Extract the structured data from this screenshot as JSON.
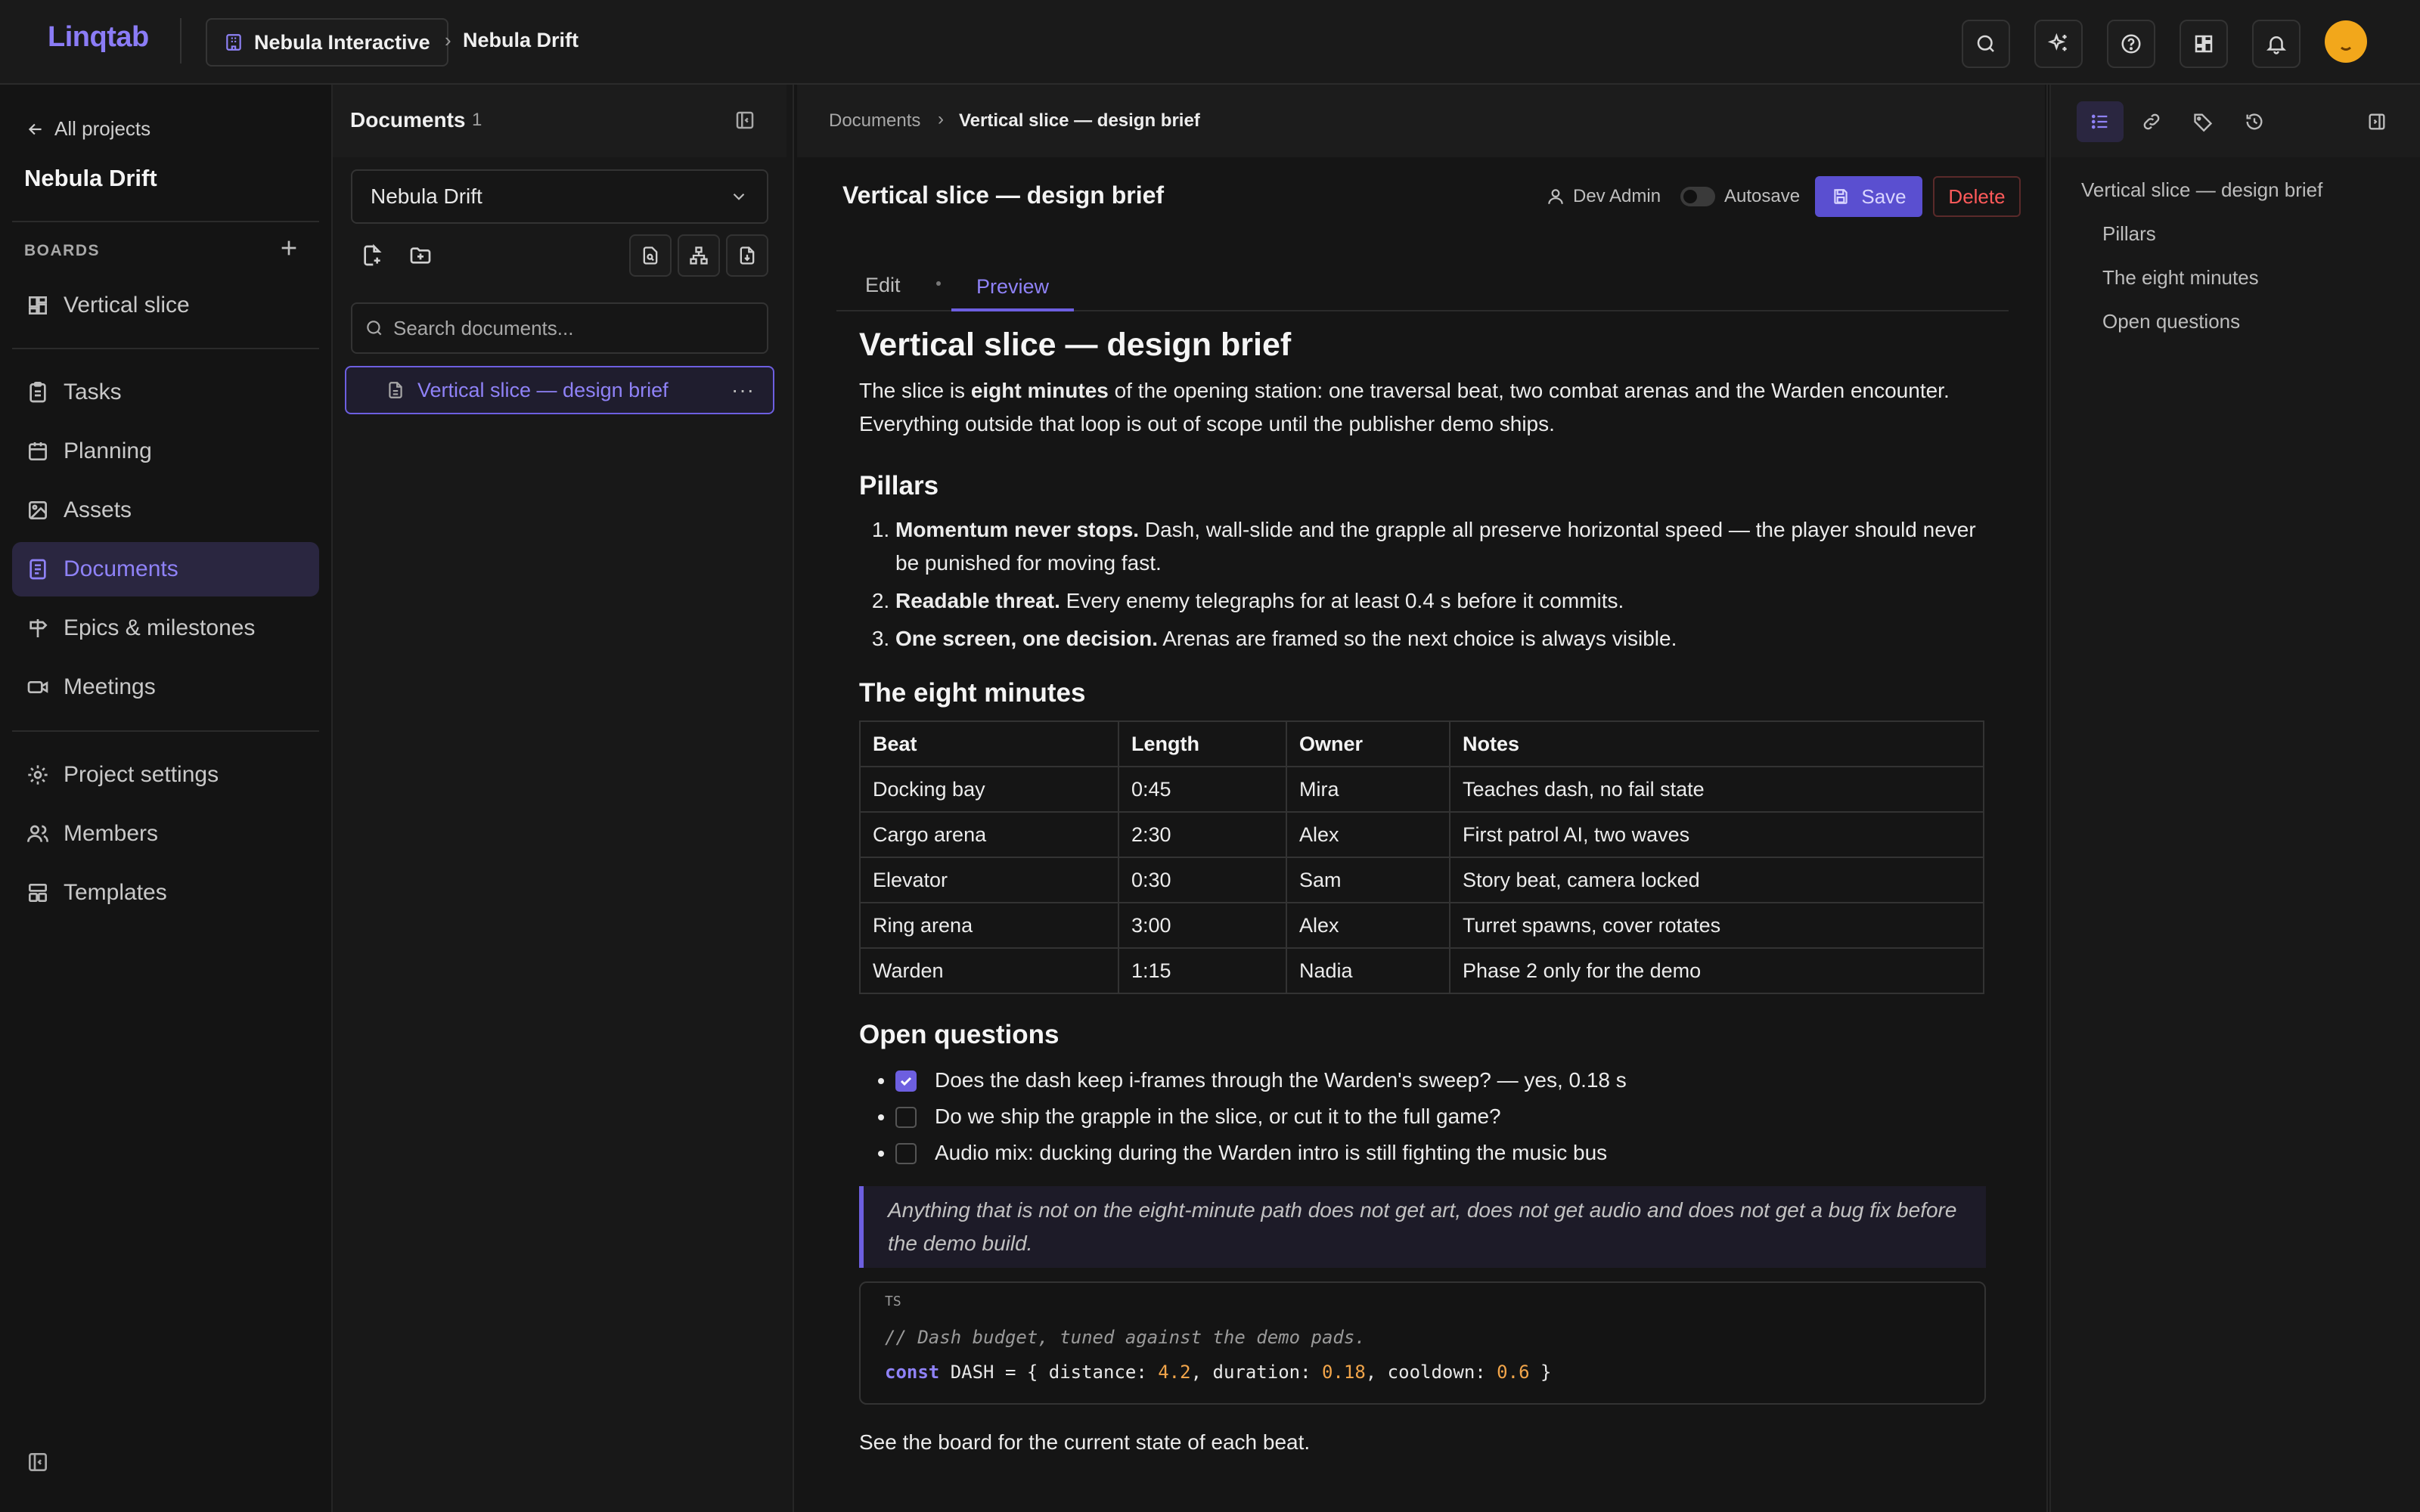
{
  "app": {
    "name": "Linqtab",
    "org": "Nebula Interactive",
    "project_crumb": "Nebula Drift",
    "crumb_separator": "›",
    "accent_color": "#8b7cf6",
    "avatar_color": "#f2a71b"
  },
  "topbar": {
    "icons": [
      "search-icon",
      "sparkles-icon",
      "help-icon",
      "apps-grid-icon",
      "bell-icon"
    ]
  },
  "sidebar": {
    "back_label": "All projects",
    "project_title": "Nebula Drift",
    "boards_label": "BOARDS",
    "boards": [
      {
        "label": "Vertical slice",
        "icon": "board-icon"
      }
    ],
    "nav": [
      {
        "label": "Tasks",
        "icon": "clipboard-icon"
      },
      {
        "label": "Planning",
        "icon": "calendar-icon"
      },
      {
        "label": "Assets",
        "icon": "image-icon"
      },
      {
        "label": "Documents",
        "icon": "document-list-icon",
        "active": true
      },
      {
        "label": "Epics & milestones",
        "icon": "signpost-icon"
      },
      {
        "label": "Meetings",
        "icon": "video-icon"
      }
    ],
    "settings_nav": [
      {
        "label": "Project settings",
        "icon": "gear-icon"
      },
      {
        "label": "Members",
        "icon": "users-icon"
      },
      {
        "label": "Templates",
        "icon": "template-icon"
      }
    ]
  },
  "documents_panel": {
    "title": "Documents",
    "count": "1",
    "project_select": "Nebula Drift",
    "search_placeholder": "Search documents...",
    "items": [
      {
        "label": "Vertical slice — design brief",
        "more": "···"
      }
    ]
  },
  "editor": {
    "breadcrumb_root": "Documents",
    "breadcrumb_sep": "›",
    "breadcrumb_current": "Vertical slice — design brief",
    "title": "Vertical slice — design brief",
    "user": "Dev Admin",
    "autosave_label": "Autosave",
    "autosave_on": false,
    "save_label": "Save",
    "delete_label": "Delete",
    "tabs": {
      "edit": "Edit",
      "preview": "Preview",
      "active": "Preview"
    }
  },
  "document": {
    "h1": "Vertical slice — design brief",
    "intro": {
      "before": "The slice is ",
      "bold": "eight minutes",
      "after": " of the opening station: one traversal beat, two combat arenas and the Warden encounter. Everything outside that loop is out of scope until the publisher demo ships."
    },
    "pillars_heading": "Pillars",
    "pillars": [
      {
        "bold": "Momentum never stops.",
        "text": " Dash, wall-slide and the grapple all preserve horizontal speed — the player should never be punished for moving fast."
      },
      {
        "bold": "Readable threat.",
        "text": " Every enemy telegraphs for at least 0.4 s before it commits."
      },
      {
        "bold": "One screen, one decision.",
        "text": " Arenas are framed so the next choice is always visible."
      }
    ],
    "beats_heading": "The eight minutes",
    "beats_columns": [
      "Beat",
      "Length",
      "Owner",
      "Notes"
    ],
    "beats_rows": [
      [
        "Docking bay",
        "0:45",
        "Mira",
        "Teaches dash, no fail state"
      ],
      [
        "Cargo arena",
        "2:30",
        "Alex",
        "First patrol AI, two waves"
      ],
      [
        "Elevator",
        "0:30",
        "Sam",
        "Story beat, camera locked"
      ],
      [
        "Ring arena",
        "3:00",
        "Alex",
        "Turret spawns, cover rotates"
      ],
      [
        "Warden",
        "1:15",
        "Nadia",
        "Phase 2 only for the demo"
      ]
    ],
    "questions_heading": "Open questions",
    "questions": [
      {
        "text": "Does the dash keep i-frames through the Warden's sweep? — yes, 0.18 s",
        "checked": true
      },
      {
        "text": "Do we ship the grapple in the slice, or cut it to the full game?",
        "checked": false
      },
      {
        "text": "Audio mix: ducking during the Warden intro is still fighting the music bus",
        "checked": false
      }
    ],
    "quote": "Anything that is not on the eight-minute path does not get art, does not get audio and does not get a bug fix before the demo build.",
    "code": {
      "lang": "TS",
      "comment": "// Dash budget, tuned against the demo pads.",
      "keyword": "const",
      "name": " DASH = { distance: ",
      "v1": "4.2",
      "mid1": ", duration: ",
      "v2": "0.18",
      "mid2": ", cooldown: ",
      "v3": "0.6",
      "end": " }"
    },
    "footer_text": "See the board for the current state of each beat."
  },
  "outline": {
    "tabs": [
      "list-icon",
      "link-icon",
      "tag-icon",
      "history-icon"
    ],
    "items": [
      {
        "label": "Vertical slice — design brief",
        "level": 1
      },
      {
        "label": "Pillars",
        "level": 2
      },
      {
        "label": "The eight minutes",
        "level": 2
      },
      {
        "label": "Open questions",
        "level": 2
      }
    ]
  }
}
